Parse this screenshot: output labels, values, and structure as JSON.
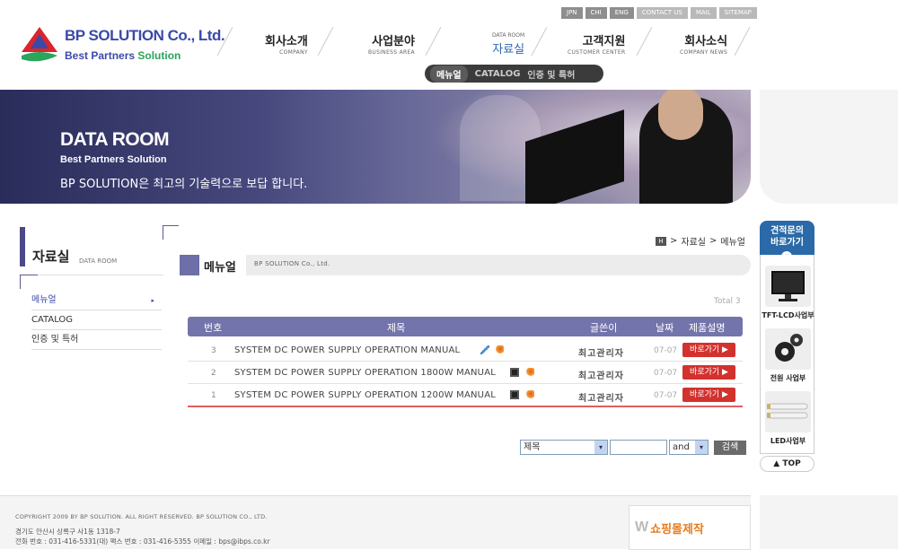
{
  "top_links": [
    "JPN",
    "CHI",
    "ENG",
    "CONTACT US",
    "MAIL",
    "SITEMAP"
  ],
  "logo": {
    "brand": "BP SOLUTION Co., Ltd.",
    "tag_a": "Best Partners ",
    "tag_b": "Solution"
  },
  "gnb": [
    {
      "ko": "회사소개",
      "en": "COMPANY"
    },
    {
      "ko": "사업분야",
      "en": "BUSINESS AREA"
    },
    {
      "small": "DATA ROOM",
      "ko": "자료실"
    },
    {
      "ko": "고객지원",
      "en": "CUSTOMER CENTER"
    },
    {
      "ko": "회사소식",
      "en": "COMPANY NEWS"
    }
  ],
  "subnav": [
    "메뉴얼",
    "CATALOG",
    "인증 및 특허"
  ],
  "banner": {
    "title": "DATA ROOM",
    "subtitle": "Best Partners Solution",
    "slogan": "BP SOLUTION은 최고의 기술력으로 보답 합니다."
  },
  "lnb": {
    "title_ko": "자료실",
    "title_en": "DATA ROOM",
    "items": [
      "메뉴얼",
      "CATALOG",
      "인증 및 특허"
    ],
    "arrow": "▸"
  },
  "breadcrumb": {
    "home": "H",
    "path1": "자료실",
    "path2": "메뉴얼",
    "sep": ">"
  },
  "page_head": {
    "title": "메뉴얼",
    "company": "BP SOLUTION Co., Ltd."
  },
  "total": "Total 3",
  "table": {
    "headers": {
      "num": "번호",
      "title": "제목",
      "writer": "글쓴이",
      "date": "날짜",
      "desc": "제품설명"
    },
    "rows": [
      {
        "num": "3",
        "title": "SYSTEM DC POWER SUPPLY OPERATION MANUAL",
        "writer": "최고관리자",
        "date": "07-07",
        "btn": "바로가기 ▶"
      },
      {
        "num": "2",
        "title": "SYSTEM DC POWER SUPPLY OPERATION 1800W MANUAL",
        "writer": "최고관리자",
        "date": "07-07",
        "btn": "바로가기 ▶"
      },
      {
        "num": "1",
        "title": "SYSTEM DC POWER SUPPLY OPERATION 1200W MANUAL",
        "writer": "최고관리자",
        "date": "07-07",
        "btn": "바로가기 ▶"
      }
    ]
  },
  "search": {
    "field": "제목",
    "op": "and",
    "button": "검색",
    "dd": "▾"
  },
  "quick": {
    "head1": "견적문의",
    "head2": "바로가기",
    "chev": "▾",
    "items": [
      "TFT-LCD사업부",
      "전원 사업부",
      "LED사업부"
    ],
    "top": "▲ TOP"
  },
  "footer": {
    "copy": "COPYRIGHT 2009 BY BP SOLUTION.  ALL RIGHT RESERVED. BP SOLUTION CO., LTD.",
    "addr": "경기도 안산시 상록구 사1동 1318-7",
    "addr2": "전화 번호 : 031-416-5331(대)     팩스 번호 : 031-416-5355   이메일 : bps@ibps.co.kr",
    "badge_logo": "W",
    "badge": "쇼핑몰제작"
  },
  "colors": {
    "accent": "#6e6ea8",
    "button": "#d2322e",
    "quick_head": "#2b6aa8"
  }
}
